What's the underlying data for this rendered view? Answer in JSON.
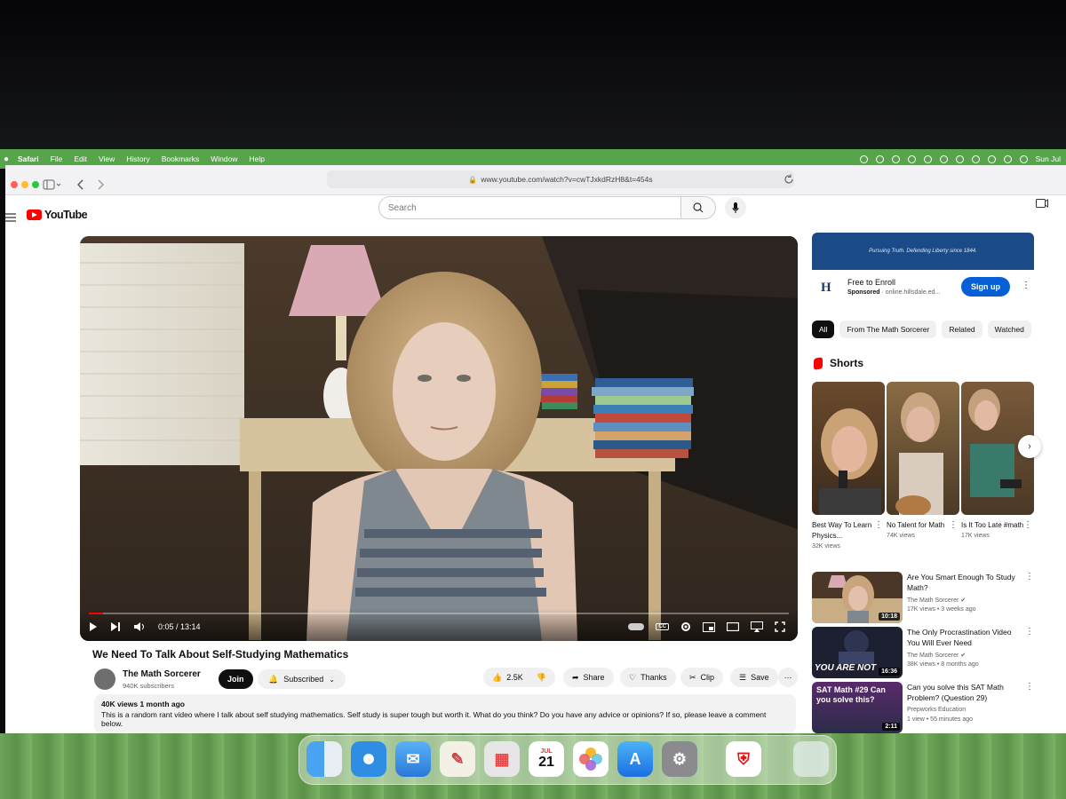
{
  "menubar": {
    "app": "Safari",
    "items": [
      "File",
      "Edit",
      "View",
      "History",
      "Bookmarks",
      "Window",
      "Help"
    ],
    "clock": "Sun Jul"
  },
  "browser": {
    "url": "www.youtube.com/watch?v=cwTJxkdRzH8&t=454s"
  },
  "youtube": {
    "logo": "YouTube",
    "search_placeholder": "Search"
  },
  "player": {
    "time": "0:05 / 13:14",
    "progress_fraction": 0.006
  },
  "video": {
    "title": "We Need To Talk About Self-Studying Mathematics",
    "channel": "The Math Sorcerer",
    "subscribers": "940K subscribers",
    "join_label": "Join",
    "subscribed_label": "Subscribed",
    "likes": "2.5K",
    "share_label": "Share",
    "thanks_label": "Thanks",
    "clip_label": "Clip",
    "save_label": "Save",
    "description_meta": "40K views  1 month ago",
    "description": "This is a random rant video where I talk about self studying mathematics. Self study is super tough but worth it. What do you think? Do you have any advice or opinions? If so, please leave a comment below."
  },
  "ad": {
    "banner_text": "Pursuing Truth. Defending Liberty since 1844.",
    "logo_letter": "H",
    "title": "Free to Enroll",
    "sponsored": "Sponsored",
    "domain": "online.hillsdale.ed...",
    "signup_label": "Sign up"
  },
  "chips": [
    "All",
    "From The Math Sorcerer",
    "Related",
    "Watched"
  ],
  "shorts": {
    "heading": "Shorts",
    "items": [
      {
        "title": "Best Way To Learn Physics...",
        "views": "32K views"
      },
      {
        "title": "No Talent for Math",
        "views": "74K views"
      },
      {
        "title": "Is It Too Late #math",
        "views": "17K views"
      }
    ]
  },
  "recommendations": [
    {
      "title": "Are You Smart Enough To Study Math?",
      "channel": "The Math Sorcerer",
      "meta": "17K views  •  3 weeks ago",
      "duration": "10:18"
    },
    {
      "title": "The Only Procrastination Video You Will Ever Need",
      "channel": "The Math Sorcerer",
      "meta": "38K views  •  8 months ago",
      "duration": "16:36",
      "thumb_text": "YOU ARE NOT"
    },
    {
      "title": "Can you solve this SAT Math Problem? (Question 29)",
      "channel": "Prepworks Education",
      "meta": "1 view  •  55 minutes ago",
      "duration": "2:11",
      "thumb_text": "SAT Math #29 Can you solve this?"
    }
  ],
  "dock": {
    "calendar_month": "JUL",
    "calendar_day": "21"
  },
  "colors": {
    "menubar": "#56a54a",
    "yt_red": "#ff0000",
    "signup_blue": "#065fd4"
  }
}
